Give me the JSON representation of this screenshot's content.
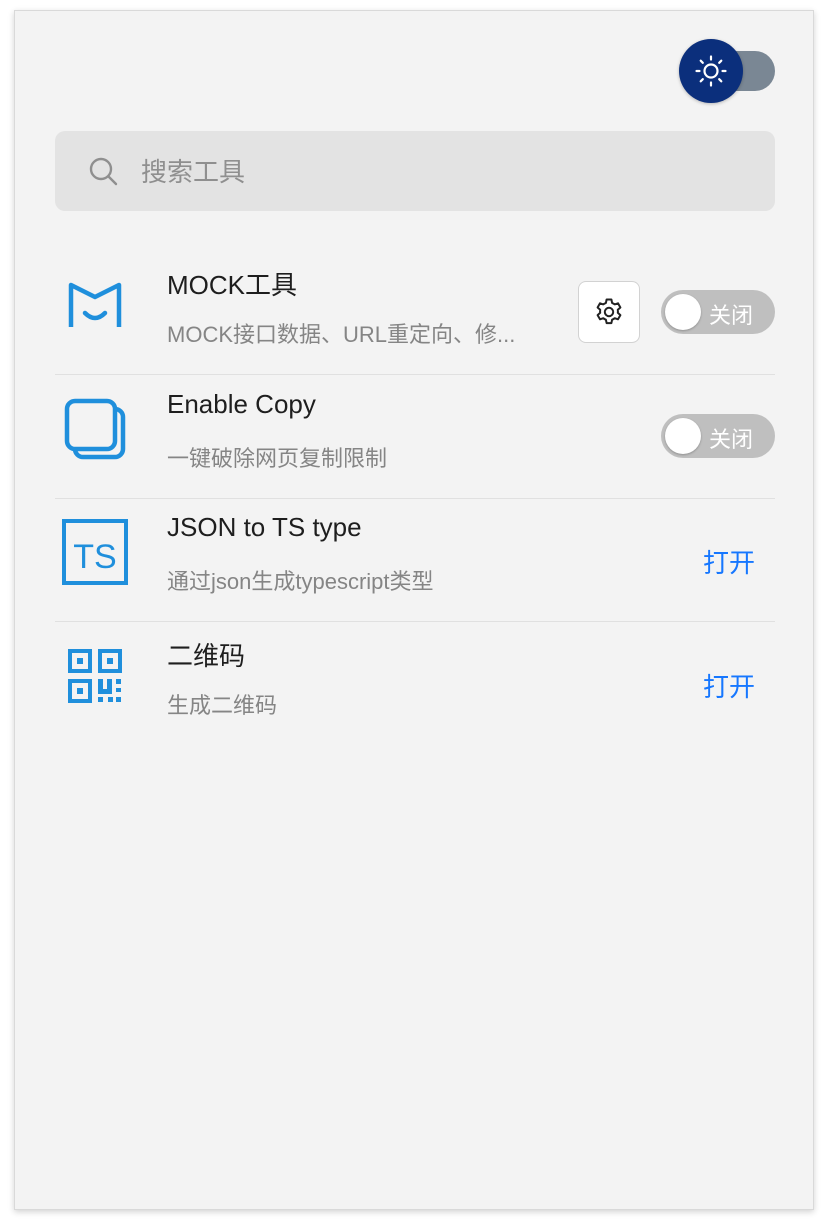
{
  "theme_toggle": {
    "mode": "light",
    "icon": "sun-icon"
  },
  "search": {
    "placeholder": "搜索工具",
    "value": "",
    "icon": "search-icon"
  },
  "tools": [
    {
      "title": "MOCK工具",
      "description": "MOCK接口数据、URL重定向、修...",
      "icon": "mock-icon",
      "has_settings": true,
      "switch_label": "关闭",
      "enabled": false
    },
    {
      "title": "Enable Copy",
      "description": "一键破除网页复制限制",
      "icon": "copy-icon",
      "switch_label": "关闭",
      "enabled": false
    },
    {
      "title": "JSON to TS type",
      "description": "通过json生成typescript类型",
      "icon": "ts-icon",
      "action_label": "打开"
    },
    {
      "title": "二维码",
      "description": "生成二维码",
      "icon": "qr-code-icon",
      "action_label": "打开"
    }
  ],
  "colors": {
    "accent": "#1677ff",
    "icon_blue": "#1f8fdc",
    "theme_knob": "#0b2f7c",
    "switch_off": "#bfbfbf"
  }
}
